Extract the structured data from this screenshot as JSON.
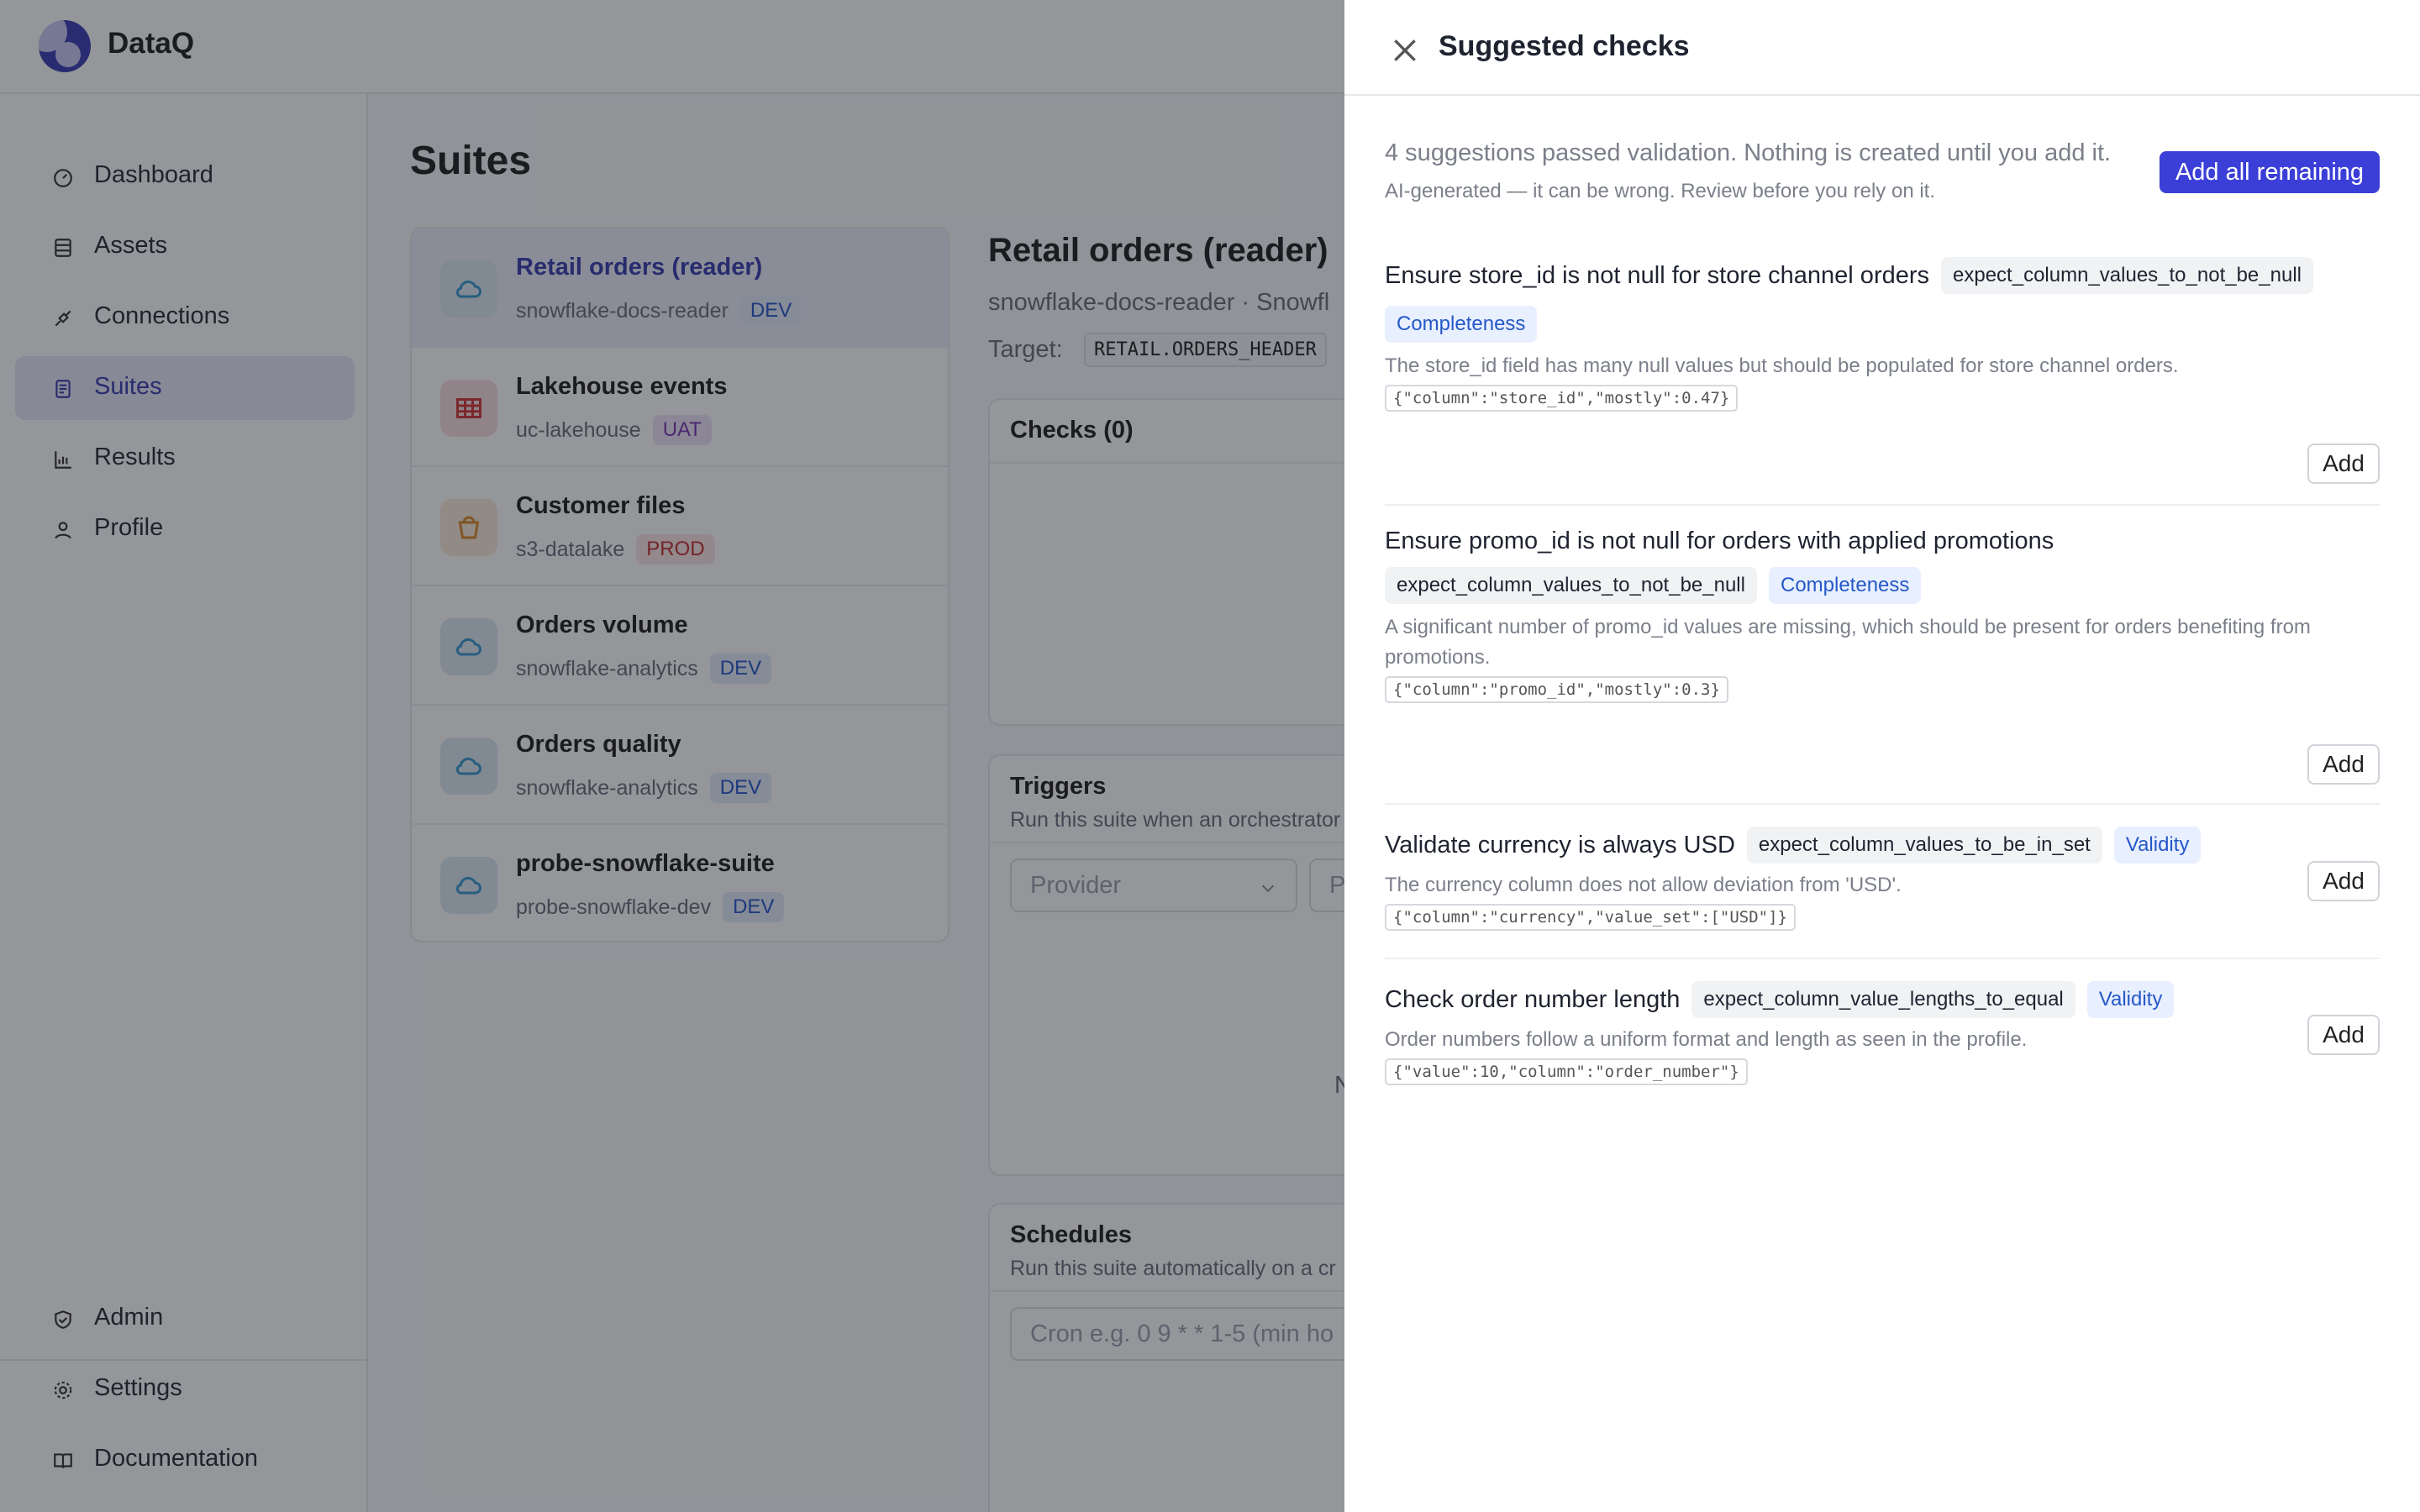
{
  "app": {
    "brand": "DataQ"
  },
  "sidebar": {
    "items": [
      {
        "label": "Dashboard",
        "icon": "dashboard-icon"
      },
      {
        "label": "Assets",
        "icon": "database-icon"
      },
      {
        "label": "Connections",
        "icon": "plug-icon"
      },
      {
        "label": "Suites",
        "icon": "document-icon",
        "active": true
      },
      {
        "label": "Results",
        "icon": "bar-chart-icon"
      },
      {
        "label": "Profile",
        "icon": "user-icon"
      }
    ],
    "bottom": [
      {
        "label": "Admin",
        "icon": "shield-icon"
      },
      {
        "label": "Settings",
        "icon": "gear-icon"
      },
      {
        "label": "Documentation",
        "icon": "book-icon"
      }
    ]
  },
  "main": {
    "title": "Suites",
    "suites": [
      {
        "name": "Retail orders (reader)",
        "connection": "snowflake-docs-reader",
        "env": "DEV",
        "icon": "cloud-icon"
      },
      {
        "name": "Lakehouse events",
        "connection": "uc-lakehouse",
        "env": "UAT",
        "icon": "table-icon"
      },
      {
        "name": "Customer files",
        "connection": "s3-datalake",
        "env": "PROD",
        "icon": "bucket-icon"
      },
      {
        "name": "Orders volume",
        "connection": "snowflake-analytics",
        "env": "DEV",
        "icon": "cloud-icon"
      },
      {
        "name": "Orders quality",
        "connection": "snowflake-analytics",
        "env": "DEV",
        "icon": "cloud-icon"
      },
      {
        "name": "probe-snowflake-suite",
        "connection": "probe-snowflake-dev",
        "env": "DEV",
        "icon": "cloud-icon"
      }
    ],
    "detail": {
      "title": "Retail orders (reader)",
      "subtitle": "snowflake-docs-reader · Snowfl",
      "target_label": "Target:",
      "target_value": "RETAIL.ORDERS_HEADER",
      "checks_title": "Checks (0)",
      "triggers_title": "Triggers",
      "triggers_sub": "Run this suite when an orchestrator",
      "provider_placeholder": "Provider",
      "second_placeholder": "P",
      "triggers_fragment": "N",
      "schedules_title": "Schedules",
      "schedules_sub": "Run this suite automatically on a cr",
      "cron_placeholder": "Cron e.g. 0 9 * * 1-5 (min ho"
    }
  },
  "drawer": {
    "title": "Suggested checks",
    "summary": "4 suggestions passed validation. Nothing is created until you add it.",
    "ai_note": "AI-generated — it can be wrong. Review before you rely on it.",
    "add_all_label": "Add all remaining",
    "add_label": "Add",
    "suggestions": [
      {
        "title": "Ensure store_id is not null for store channel orders",
        "expectation": "expect_column_values_to_not_be_null",
        "category": "Completeness",
        "description": "The store_id field has many null values but should be populated for store channel orders.",
        "kwargs": "{\"column\":\"store_id\",\"mostly\":0.47}"
      },
      {
        "title": "Ensure promo_id is not null for orders with applied promotions",
        "expectation": "expect_column_values_to_not_be_null",
        "category": "Completeness",
        "description": "A significant number of promo_id values are missing, which should be present for orders benefiting from promotions.",
        "kwargs": "{\"column\":\"promo_id\",\"mostly\":0.3}"
      },
      {
        "title": "Validate currency is always USD",
        "expectation": "expect_column_values_to_be_in_set",
        "category": "Validity",
        "description": "The currency column does not allow deviation from 'USD'.",
        "kwargs": "{\"column\":\"currency\",\"value_set\":[\"USD\"]}"
      },
      {
        "title": "Check order number length",
        "expectation": "expect_column_value_lengths_to_equal",
        "category": "Validity",
        "description": "Order numbers follow a uniform format and length as seen in the profile.",
        "kwargs": "{\"value\":10,\"column\":\"order_number\"}"
      }
    ]
  },
  "colors": {
    "accent": "#3b3fd8",
    "active_nav_bg": "#e6e7f7",
    "category_tag": "#2558c8"
  }
}
